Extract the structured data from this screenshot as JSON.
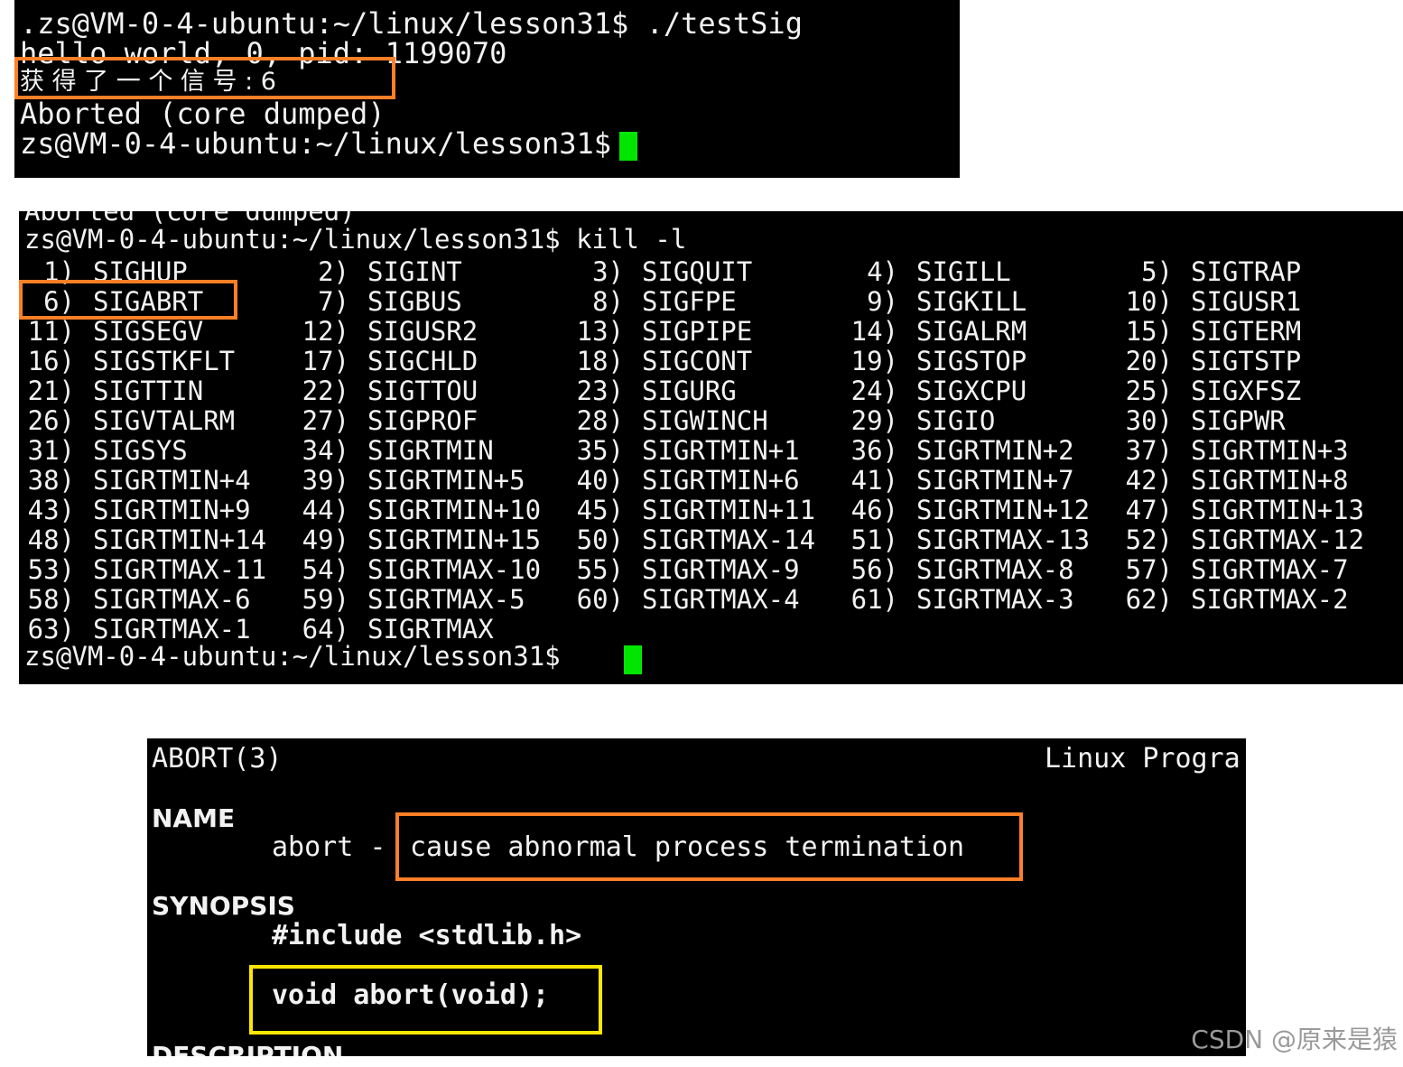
{
  "terminal1": {
    "lines": [
      ".zs@VM-0-4-ubuntu:~/linux/lesson31$ ./testSig",
      "hello world, 0, pid: 1199070",
      "获 得 了 一 个 信 号 : 6",
      "Aborted (core dumped)",
      "zs@VM-0-4-ubuntu:~/linux/lesson31$ "
    ]
  },
  "terminal2": {
    "top_clipped": "Aborted (core dumped)",
    "command": "zs@VM-0-4-ubuntu:~/linux/lesson31$ kill -l",
    "signals": [
      {
        "num": "1)",
        "name": "SIGHUP"
      },
      {
        "num": "2)",
        "name": "SIGINT"
      },
      {
        "num": "3)",
        "name": "SIGQUIT"
      },
      {
        "num": "4)",
        "name": "SIGILL"
      },
      {
        "num": "5)",
        "name": "SIGTRAP"
      },
      {
        "num": "6)",
        "name": "SIGABRT"
      },
      {
        "num": "7)",
        "name": "SIGBUS"
      },
      {
        "num": "8)",
        "name": "SIGFPE"
      },
      {
        "num": "9)",
        "name": "SIGKILL"
      },
      {
        "num": "10)",
        "name": "SIGUSR1"
      },
      {
        "num": "11)",
        "name": "SIGSEGV"
      },
      {
        "num": "12)",
        "name": "SIGUSR2"
      },
      {
        "num": "13)",
        "name": "SIGPIPE"
      },
      {
        "num": "14)",
        "name": "SIGALRM"
      },
      {
        "num": "15)",
        "name": "SIGTERM"
      },
      {
        "num": "16)",
        "name": "SIGSTKFLT"
      },
      {
        "num": "17)",
        "name": "SIGCHLD"
      },
      {
        "num": "18)",
        "name": "SIGCONT"
      },
      {
        "num": "19)",
        "name": "SIGSTOP"
      },
      {
        "num": "20)",
        "name": "SIGTSTP"
      },
      {
        "num": "21)",
        "name": "SIGTTIN"
      },
      {
        "num": "22)",
        "name": "SIGTTOU"
      },
      {
        "num": "23)",
        "name": "SIGURG"
      },
      {
        "num": "24)",
        "name": "SIGXCPU"
      },
      {
        "num": "25)",
        "name": "SIGXFSZ"
      },
      {
        "num": "26)",
        "name": "SIGVTALRM"
      },
      {
        "num": "27)",
        "name": "SIGPROF"
      },
      {
        "num": "28)",
        "name": "SIGWINCH"
      },
      {
        "num": "29)",
        "name": "SIGIO"
      },
      {
        "num": "30)",
        "name": "SIGPWR"
      },
      {
        "num": "31)",
        "name": "SIGSYS"
      },
      {
        "num": "34)",
        "name": "SIGRTMIN"
      },
      {
        "num": "35)",
        "name": "SIGRTMIN+1"
      },
      {
        "num": "36)",
        "name": "SIGRTMIN+2"
      },
      {
        "num": "37)",
        "name": "SIGRTMIN+3"
      },
      {
        "num": "38)",
        "name": "SIGRTMIN+4"
      },
      {
        "num": "39)",
        "name": "SIGRTMIN+5"
      },
      {
        "num": "40)",
        "name": "SIGRTMIN+6"
      },
      {
        "num": "41)",
        "name": "SIGRTMIN+7"
      },
      {
        "num": "42)",
        "name": "SIGRTMIN+8"
      },
      {
        "num": "43)",
        "name": "SIGRTMIN+9"
      },
      {
        "num": "44)",
        "name": "SIGRTMIN+10"
      },
      {
        "num": "45)",
        "name": "SIGRTMIN+11"
      },
      {
        "num": "46)",
        "name": "SIGRTMIN+12"
      },
      {
        "num": "47)",
        "name": "SIGRTMIN+13"
      },
      {
        "num": "48)",
        "name": "SIGRTMIN+14"
      },
      {
        "num": "49)",
        "name": "SIGRTMIN+15"
      },
      {
        "num": "50)",
        "name": "SIGRTMAX-14"
      },
      {
        "num": "51)",
        "name": "SIGRTMAX-13"
      },
      {
        "num": "52)",
        "name": "SIGRTMAX-12"
      },
      {
        "num": "53)",
        "name": "SIGRTMAX-11"
      },
      {
        "num": "54)",
        "name": "SIGRTMAX-10"
      },
      {
        "num": "55)",
        "name": "SIGRTMAX-9"
      },
      {
        "num": "56)",
        "name": "SIGRTMAX-8"
      },
      {
        "num": "57)",
        "name": "SIGRTMAX-7"
      },
      {
        "num": "58)",
        "name": "SIGRTMAX-6"
      },
      {
        "num": "59)",
        "name": "SIGRTMAX-5"
      },
      {
        "num": "60)",
        "name": "SIGRTMAX-4"
      },
      {
        "num": "61)",
        "name": "SIGRTMAX-3"
      },
      {
        "num": "62)",
        "name": "SIGRTMAX-2"
      },
      {
        "num": "63)",
        "name": "SIGRTMAX-1"
      },
      {
        "num": "64)",
        "name": "SIGRTMAX"
      }
    ],
    "prompt": "zs@VM-0-4-ubuntu:~/linux/lesson31$ "
  },
  "terminal3": {
    "header_left": "ABORT(3)",
    "header_right": "Linux Progra",
    "name_heading": "NAME",
    "name_prefix": "abort - ",
    "name_desc": "cause abnormal process termination",
    "synopsis_heading": "SYNOPSIS",
    "include": "#include <stdlib.h>",
    "prototype": "void abort(void);",
    "description_heading": "DESCRIPTION"
  },
  "watermark": "CSDN @原来是猿",
  "colors": {
    "terminal_bg": "#000000",
    "text": "#f2f2f2",
    "cursor": "#00e600",
    "highlight_orange": "#ff7f27",
    "highlight_yellow": "#ffe600"
  }
}
